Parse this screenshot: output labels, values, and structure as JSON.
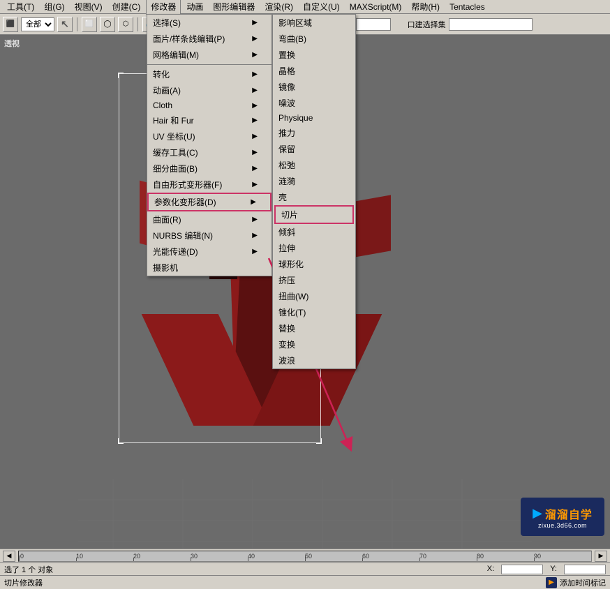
{
  "menubar": {
    "items": [
      {
        "label": "工具(T)",
        "key": "tools"
      },
      {
        "label": "组(G)",
        "key": "group"
      },
      {
        "label": "视图(V)",
        "key": "view"
      },
      {
        "label": "创建(C)",
        "key": "create"
      },
      {
        "label": "修改器",
        "key": "modifier",
        "active": true
      },
      {
        "label": "动画",
        "key": "animation"
      },
      {
        "label": "图形编辑器",
        "key": "graph-editor"
      },
      {
        "label": "渲染(R)",
        "key": "render"
      },
      {
        "label": "自定义(U)",
        "key": "customize"
      },
      {
        "label": "MAXScript(M)",
        "key": "maxscript"
      },
      {
        "label": "帮助(H)",
        "key": "help"
      },
      {
        "label": "Tentacles",
        "key": "tentacles"
      }
    ]
  },
  "modify_menu": {
    "items": [
      {
        "label": "选择(S)",
        "has_sub": true,
        "key": "select"
      },
      {
        "label": "面片/样条线编辑(P)",
        "has_sub": true,
        "key": "patch"
      },
      {
        "label": "网格编辑(M)",
        "has_sub": true,
        "key": "mesh"
      },
      {
        "label": "转化",
        "has_sub": true,
        "key": "convert"
      },
      {
        "label": "动画(A)",
        "has_sub": true,
        "key": "anim"
      },
      {
        "label": "Cloth",
        "has_sub": true,
        "key": "cloth"
      },
      {
        "label": "Hair 和 Fur",
        "has_sub": true,
        "key": "hair"
      },
      {
        "label": "UV 坐标(U)",
        "has_sub": true,
        "key": "uv"
      },
      {
        "label": "缓存工具(C)",
        "has_sub": true,
        "key": "cache"
      },
      {
        "label": "细分曲面(B)",
        "has_sub": true,
        "key": "subdivide"
      },
      {
        "label": "自由形式变形器(F)",
        "has_sub": true,
        "key": "ffd"
      },
      {
        "label": "参数化变形器(D)",
        "has_sub": true,
        "key": "parametric",
        "highlighted": true
      },
      {
        "label": "曲面(R)",
        "has_sub": true,
        "key": "surface"
      },
      {
        "label": "NURBS 编辑(N)",
        "has_sub": true,
        "key": "nurbs"
      },
      {
        "label": "光能传递(D)",
        "has_sub": true,
        "key": "radiosity"
      },
      {
        "label": "摄影机",
        "has_sub": false,
        "key": "camera"
      }
    ]
  },
  "parametric_submenu": {
    "items": [
      {
        "label": "影响区域",
        "key": "affect-region"
      },
      {
        "label": "弯曲(B)",
        "key": "bend"
      },
      {
        "label": "置换",
        "key": "displace"
      },
      {
        "label": "晶格",
        "key": "lattice"
      },
      {
        "label": "镜像",
        "key": "mirror"
      },
      {
        "label": "噪波",
        "key": "noise"
      },
      {
        "label": "Physique",
        "key": "physique"
      },
      {
        "label": "推力",
        "key": "push"
      },
      {
        "label": "保留",
        "key": "preserve"
      },
      {
        "label": "松弛",
        "key": "relax"
      },
      {
        "label": "涟漪",
        "key": "ripple"
      },
      {
        "label": "壳",
        "key": "shell"
      },
      {
        "label": "切片",
        "key": "slice",
        "highlighted": true
      },
      {
        "label": "倾斜",
        "key": "skew"
      },
      {
        "label": "拉伸",
        "key": "stretch"
      },
      {
        "label": "球形化",
        "key": "spherify"
      },
      {
        "label": "挤压",
        "key": "squeeze"
      },
      {
        "label": "扭曲(W)",
        "key": "twist"
      },
      {
        "label": "锥化(T)",
        "key": "taper"
      },
      {
        "label": "替换",
        "key": "substitute"
      },
      {
        "label": "变换",
        "key": "xform"
      },
      {
        "label": "波浪",
        "key": "wave"
      }
    ]
  },
  "toolbar": {
    "select_all": "全部",
    "select_input": ""
  },
  "viewport": {
    "label": "透视",
    "bg_color": "#6b6b6b"
  },
  "statusbar": {
    "selection_text": "选了 1 个 对象",
    "coord_x": "X:",
    "coord_y": "Y:",
    "coord_value": ""
  },
  "modifier_status": {
    "label": "切片修改器",
    "add_time": "添加时间标记"
  },
  "timeline": {
    "ticks": [
      "0",
      "10",
      "20",
      "30",
      "40",
      "50",
      "60",
      "70",
      "80",
      "90"
    ],
    "current": "0"
  },
  "watermark": {
    "line1": "溜溜自学",
    "line2": "zixue.3d66.com"
  }
}
